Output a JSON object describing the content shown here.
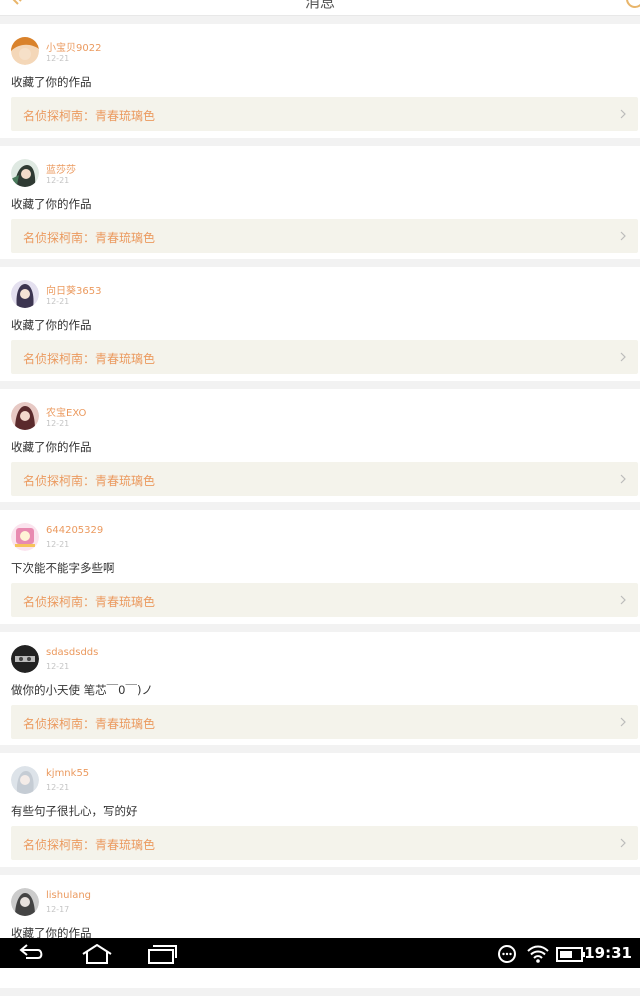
{
  "header": {
    "title": "消息"
  },
  "messages": [
    {
      "username": "小宝贝9022",
      "date": "12-21",
      "text": "收藏了你的作品",
      "work_title": "名侦探柯南：青春琉璃色",
      "avatar_color": "#d9822b"
    },
    {
      "username": "蓝莎莎",
      "date": "12-21",
      "text": "收藏了你的作品",
      "work_title": "名侦探柯南：青春琉璃色",
      "avatar_color": "#4a7a5c"
    },
    {
      "username": "向日葵3653",
      "date": "12-21",
      "text": "收藏了你的作品",
      "work_title": "名侦探柯南：青春琉璃色",
      "avatar_color": "#7a6fa8"
    },
    {
      "username": "农宝EXO",
      "date": "12-21",
      "text": "收藏了你的作品",
      "work_title": "名侦探柯南：青春琉璃色",
      "avatar_color": "#a8464a"
    },
    {
      "username": "644205329",
      "date": "12-21",
      "text": "下次能不能字多些啊",
      "work_title": "名侦探柯南：青春琉璃色",
      "avatar_color": "#e88ab0"
    },
    {
      "username": "sdasdsdds",
      "date": "12-21",
      "text": "做你的小天使 笔芯￣0￣)ノ",
      "work_title": "名侦探柯南：青春琉璃色",
      "avatar_color": "#333333"
    },
    {
      "username": "kjmnk55",
      "date": "12-21",
      "text": "有些句子很扎心，写的好",
      "work_title": "名侦探柯南：青春琉璃色",
      "avatar_color": "#b9c2cc"
    },
    {
      "username": "lishulang",
      "date": "12-17",
      "text": "收藏了你的作品",
      "work_title": "",
      "avatar_color": "#555555"
    }
  ],
  "status_bar": {
    "time": "19:31"
  },
  "colors": {
    "accent": "#eb9a5f",
    "work_bg": "#f4f3eb",
    "page_bg": "#f2f2f2"
  }
}
